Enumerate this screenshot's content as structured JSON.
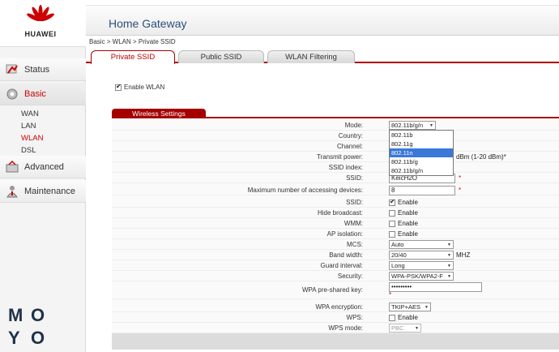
{
  "brand": {
    "name": "HUAWEI",
    "accent": "#cc0000"
  },
  "header": {
    "title": "Home Gateway"
  },
  "breadcrumb": "Basic > WLAN > Private SSID",
  "sidebar": {
    "main": [
      {
        "label": "Status",
        "icon": "status-icon"
      },
      {
        "label": "Basic",
        "icon": "basic-icon",
        "active": true
      },
      {
        "label": "Advanced",
        "icon": "advanced-icon"
      },
      {
        "label": "Maintenance",
        "icon": "maintenance-icon"
      }
    ],
    "sub": [
      {
        "label": "WAN"
      },
      {
        "label": "LAN"
      },
      {
        "label": "WLAN",
        "active": true
      },
      {
        "label": "DSL"
      }
    ]
  },
  "tabs": [
    {
      "label": "Private SSID",
      "active": true
    },
    {
      "label": "Public SSID"
    },
    {
      "label": "WLAN Filtering"
    }
  ],
  "enable_wlan": {
    "label": "Enable WLAN",
    "checked": true
  },
  "section": {
    "title": "Wireless Settings"
  },
  "form": {
    "mode": {
      "label": "Mode:",
      "value": "802.11b/g/n"
    },
    "mode_options": [
      "802.11b",
      "802.11g",
      "802.11n",
      "802.11b/g",
      "802.11b/g/n"
    ],
    "country": {
      "label": "Country:"
    },
    "channel": {
      "label": "Channel:"
    },
    "transmit_power": {
      "label": "Transmit power:",
      "suffix": "dBm (1-20 dBm)*"
    },
    "ssid_index": {
      "label": "SSID index:"
    },
    "ssid": {
      "label": "SSID:",
      "value": "KeicH2O"
    },
    "max_devices": {
      "label": "Maximum number of accessing devices:",
      "value": "8"
    },
    "ssid_enable": {
      "label": "SSID:",
      "option": "Enable"
    },
    "hide_broadcast": {
      "label": "Hide broadcast:",
      "option": "Enable"
    },
    "wmm": {
      "label": "WMM:",
      "option": "Enable"
    },
    "ap_isolation": {
      "label": "AP isolation:",
      "option": "Enable"
    },
    "mcs": {
      "label": "MCS:",
      "value": "Auto"
    },
    "band_width": {
      "label": "Band width:",
      "value": "20/40",
      "suffix": "MHZ"
    },
    "guard_interval": {
      "label": "Guard interval:",
      "value": "Long"
    },
    "security": {
      "label": "Security:",
      "value": "WPA-PSK/WPA2-F"
    },
    "wpa_key": {
      "label": "WPA pre-shared key:",
      "value": "•••••••••"
    },
    "wpa_encryption": {
      "label": "WPA encryption:",
      "value": "TKIP+AES"
    },
    "wps": {
      "label": "WPS:",
      "option": "Enable"
    },
    "wps_mode": {
      "label": "WPS mode:",
      "value": "PBC"
    },
    "required_mark": "*"
  },
  "watermark": {
    "letters": [
      "M",
      "O",
      "Y",
      "O"
    ]
  }
}
